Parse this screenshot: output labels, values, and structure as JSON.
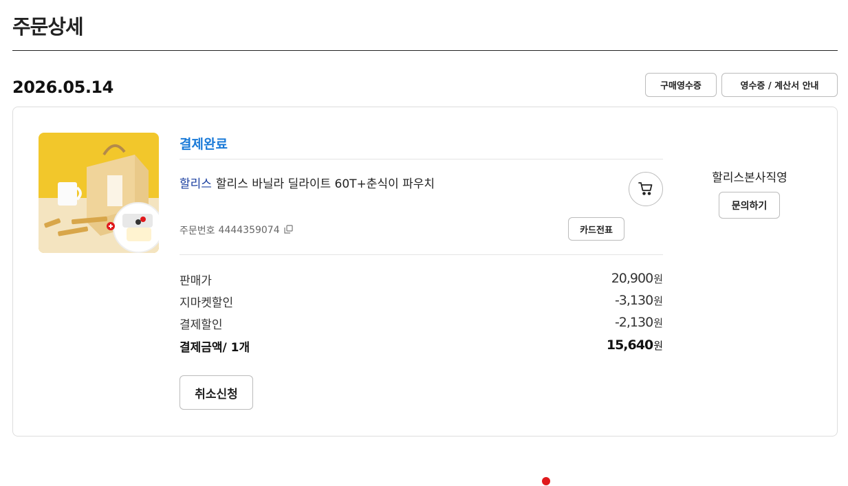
{
  "page": {
    "title": "주문상세"
  },
  "order": {
    "date": "2026.05.14",
    "actions": {
      "receipt_label": "구매영수증",
      "invoice_label": "영수증 / 계산서 안내"
    },
    "status": "결제완료",
    "product": {
      "brand": "할리스",
      "name": "할리스 바닐라 딜라이트 60T+춘식이 파우치"
    },
    "order_number_label": "주문번호",
    "order_number": "4444359074",
    "card_slip_label": "카드전표",
    "seller": {
      "name": "할리스본사직영",
      "inquiry_label": "문의하기"
    },
    "prices": [
      {
        "label": "판매가",
        "value": "20,900",
        "unit": "원"
      },
      {
        "label": "지마켓할인",
        "value": "-3,130",
        "unit": "원"
      },
      {
        "label": "결제할인",
        "value": "-2,130",
        "unit": "원"
      },
      {
        "label": "결제금액/ 1개",
        "value": "15,640",
        "unit": "원"
      }
    ],
    "cancel_label": "취소신청"
  },
  "colors": {
    "status": "#1a7ad8",
    "brand": "#1a3fa0",
    "dot": "#e0191c",
    "thumb_bg": "#f2c72b"
  },
  "icons": {
    "cart": "cart-icon",
    "copy": "copy-icon"
  }
}
